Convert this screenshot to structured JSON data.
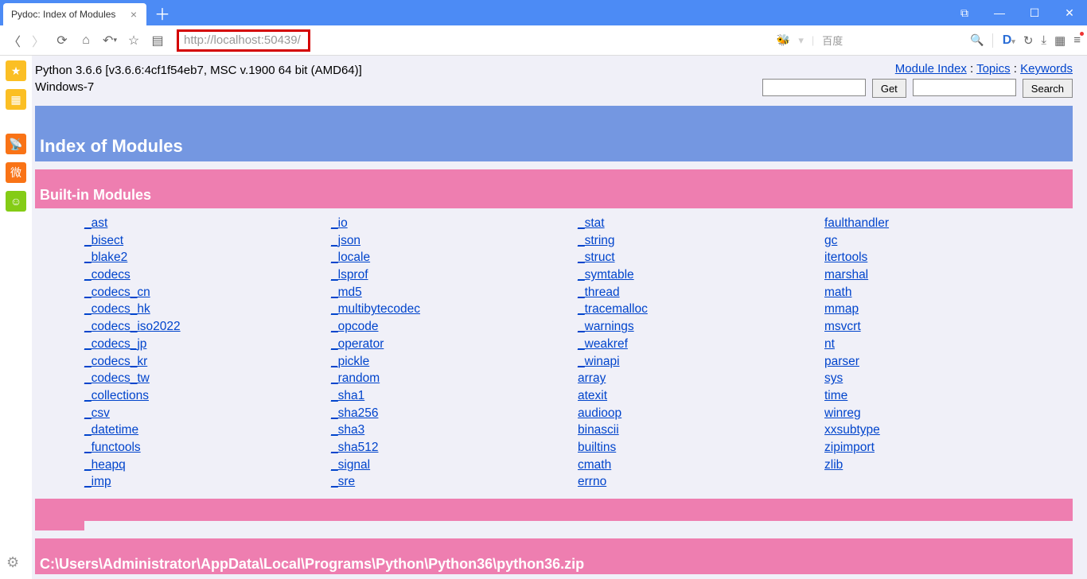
{
  "browser": {
    "tab_title": "Pydoc: Index of Modules",
    "url": "http://localhost:50439/",
    "search_provider": "百度"
  },
  "header": {
    "python_version": "Python 3.6.6 [v3.6.6:4cf1f54eb7, MSC v.1900 64 bit (AMD64)]",
    "platform": "Windows-7",
    "link_module_index": "Module Index",
    "link_topics": "Topics",
    "link_keywords": "Keywords",
    "btn_get": "Get",
    "btn_search": "Search"
  },
  "titles": {
    "index": "Index of Modules",
    "builtin": "Built-in Modules",
    "path": "C:\\Users\\Administrator\\AppData\\Local\\Programs\\Python\\Python36\\python36.zip"
  },
  "modules": {
    "col1": [
      "_ast",
      "_bisect",
      "_blake2",
      "_codecs",
      "_codecs_cn",
      "_codecs_hk",
      "_codecs_iso2022",
      "_codecs_jp",
      "_codecs_kr",
      "_codecs_tw",
      "_collections",
      "_csv",
      "_datetime",
      "_functools",
      "_heapq",
      "_imp"
    ],
    "col2": [
      "_io",
      "_json",
      "_locale",
      "_lsprof",
      "_md5",
      "_multibytecodec",
      "_opcode",
      "_operator",
      "_pickle",
      "_random",
      "_sha1",
      "_sha256",
      "_sha3",
      "_sha512",
      "_signal",
      "_sre"
    ],
    "col3": [
      "_stat",
      "_string",
      "_struct",
      "_symtable",
      "_thread",
      "_tracemalloc",
      "_warnings",
      "_weakref",
      "_winapi",
      "array",
      "atexit",
      "audioop",
      "binascii",
      "builtins",
      "cmath",
      "errno"
    ],
    "col4": [
      "faulthandler",
      "gc",
      "itertools",
      "marshal",
      "math",
      "mmap",
      "msvcrt",
      "nt",
      "parser",
      "sys",
      "time",
      "winreg",
      "xxsubtype",
      "zipimport",
      "zlib"
    ]
  }
}
